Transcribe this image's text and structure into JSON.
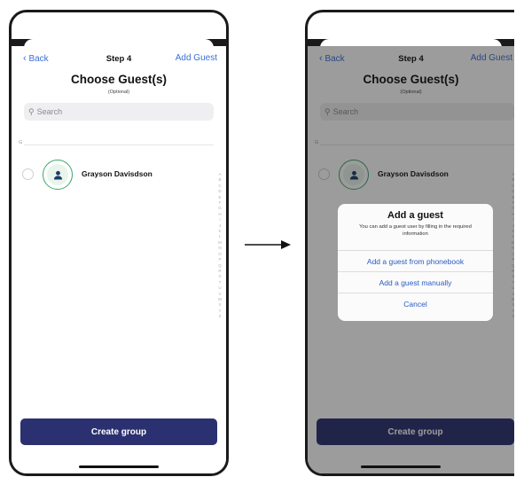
{
  "screen": {
    "nav": {
      "back_label": "Back",
      "step_label": "Step 4",
      "add_guest_label": "Add Guest"
    },
    "title": "Choose Guest(s)",
    "subtitle": "(Optional)",
    "search": {
      "placeholder": "Search"
    },
    "section_letter": "G",
    "guests": [
      {
        "name": "Grayson Davisdson",
        "selected": false
      }
    ],
    "index_letters": [
      "A",
      "B",
      "C",
      "D",
      "E",
      "F",
      "G",
      "H",
      "I",
      "J",
      "K",
      "L",
      "M",
      "N",
      "O",
      "P",
      "Q",
      "R",
      "S",
      "T",
      "U",
      "V",
      "W",
      "X",
      "Y",
      "Z"
    ],
    "create_button_label": "Create group"
  },
  "dialog": {
    "title": "Add a guest",
    "message": "You can add a guest user by filling in the required information",
    "options": [
      "Add a guest from phonebook",
      "Add a guest manually",
      "Cancel"
    ]
  },
  "colors": {
    "accent_blue": "#3a6fd8",
    "button_navy": "#2b3170",
    "avatar_green": "#39a86a",
    "avatar_icon": "#1f3a66"
  },
  "icons": {
    "back": "chevron-left-icon",
    "search": "search-icon",
    "avatar": "person-icon",
    "transition": "arrow-right-icon"
  }
}
